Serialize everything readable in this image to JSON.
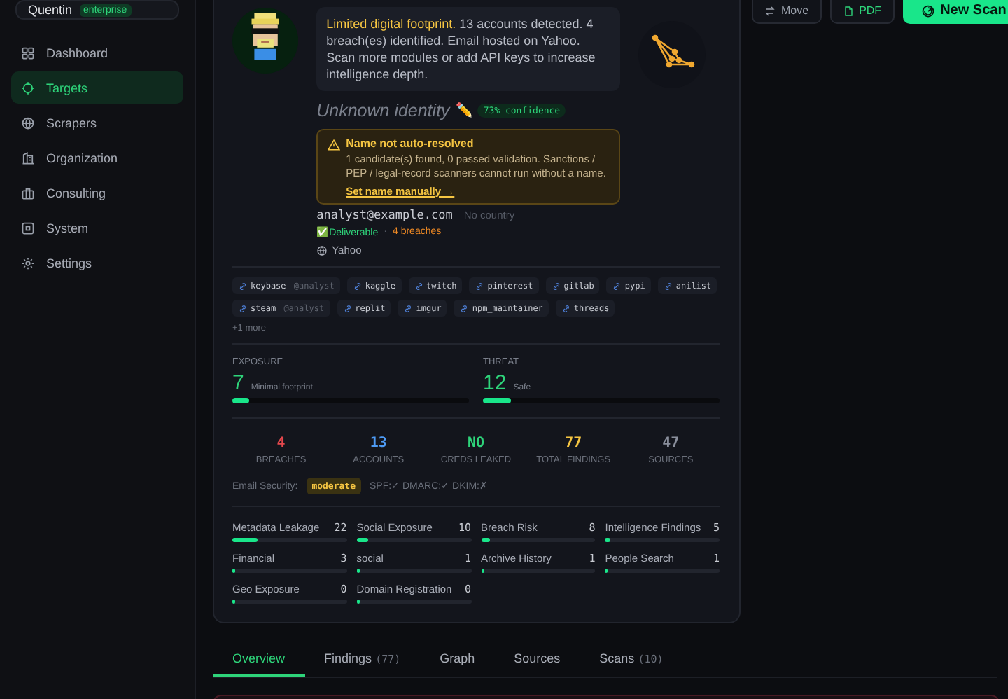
{
  "sidebar": {
    "user": {
      "name": "Quentin",
      "plan": "enterprise"
    },
    "items": [
      {
        "label": "Dashboard",
        "kind": "grid",
        "selected": false
      },
      {
        "label": "Targets",
        "kind": "target",
        "selected": true
      },
      {
        "label": "Scrapers",
        "kind": "globe",
        "selected": false
      },
      {
        "label": "Organization",
        "kind": "building",
        "selected": false
      },
      {
        "label": "Consulting",
        "kind": "briefcase",
        "selected": false
      },
      {
        "label": "System",
        "kind": "chip",
        "selected": false
      },
      {
        "label": "Settings",
        "kind": "gear",
        "selected": false
      }
    ]
  },
  "toolbar": [
    {
      "label": "Move",
      "kind": "move"
    },
    {
      "label": "PDF",
      "kind": "pdf"
    },
    {
      "label": "New Scan",
      "kind": "primary"
    }
  ],
  "profile": {
    "summary": {
      "lead": "Limited digital footprint.",
      "text": "13 accounts detected. 4 breach(es) identified. Email hosted on Yahoo. Scan more modules or add API keys to increase intelligence depth."
    },
    "identity": {
      "name": "Unknown identity",
      "edit": "✏️",
      "confidence": "73% confidence"
    },
    "warning": {
      "title": "Name not auto-resolved",
      "text": "1 candidate(s) found, 0 passed validation. Sanctions / PEP / legal-record scanners cannot run without a name.",
      "link": "Set name manually →"
    },
    "email": {
      "address": "analyst@example.com",
      "country": "No country",
      "deliverable": "✅Deliverable",
      "separator": "·",
      "breaches": "4 breaches",
      "provider": "Yahoo"
    },
    "accounts": [
      {
        "site": "keybase",
        "handle": "@analyst"
      },
      {
        "site": "kaggle"
      },
      {
        "site": "twitch"
      },
      {
        "site": "pinterest"
      },
      {
        "site": "gitlab"
      },
      {
        "site": "pypi"
      },
      {
        "site": "anilist"
      },
      {
        "site": "steam",
        "handle": "@analyst"
      },
      {
        "site": "replit"
      },
      {
        "site": "imgur"
      },
      {
        "site": "npm_maintainer"
      },
      {
        "site": "threads"
      }
    ],
    "more": "+1 more",
    "scores": [
      {
        "label": "EXPOSURE",
        "value": "7",
        "note": "Minimal footprint",
        "level": 0.07
      },
      {
        "label": "THREAT",
        "value": "12",
        "note": "Safe",
        "level": 0.12
      }
    ],
    "stats": [
      {
        "value": "4",
        "label": "BREACHES",
        "color": "#e5484d"
      },
      {
        "value": "13",
        "label": "ACCOUNTS",
        "color": "#4e9bf5"
      },
      {
        "value": "NO",
        "label": "CREDS LEAKED",
        "color": "#2ed47a"
      },
      {
        "value": "77",
        "label": "TOTAL FINDINGS",
        "color": "#f5c542"
      },
      {
        "value": "47",
        "label": "SOURCES",
        "color": "#8a8f9c"
      }
    ],
    "email_security": {
      "label": "Email Security:",
      "rating": "moderate",
      "checks": "SPF:✓ DMARC:✓ DKIM:✗"
    },
    "categories": [
      {
        "name": "Metadata Leakage",
        "count": "22",
        "level": 0.22
      },
      {
        "name": "Social Exposure",
        "count": "10",
        "level": 0.1
      },
      {
        "name": "Breach Risk",
        "count": "8",
        "level": 0.08
      },
      {
        "name": "Intelligence Findings",
        "count": "5",
        "level": 0.05
      },
      {
        "name": "Financial",
        "count": "3",
        "level": 0.03
      },
      {
        "name": "social",
        "count": "1",
        "level": 0.01
      },
      {
        "name": "Archive History",
        "count": "1",
        "level": 0.01
      },
      {
        "name": "People Search",
        "count": "1",
        "level": 0.01
      },
      {
        "name": "Geo Exposure",
        "count": "0",
        "level": 0
      },
      {
        "name": "Domain Registration",
        "count": "0",
        "level": 0
      }
    ]
  },
  "tabs": [
    {
      "label": "Overview",
      "selected": true
    },
    {
      "label": "Findings",
      "count": "(77)",
      "selected": false
    },
    {
      "label": "Graph",
      "selected": false
    },
    {
      "label": "Sources",
      "selected": false
    },
    {
      "label": "Scans",
      "count": "(10)",
      "selected": false
    }
  ]
}
